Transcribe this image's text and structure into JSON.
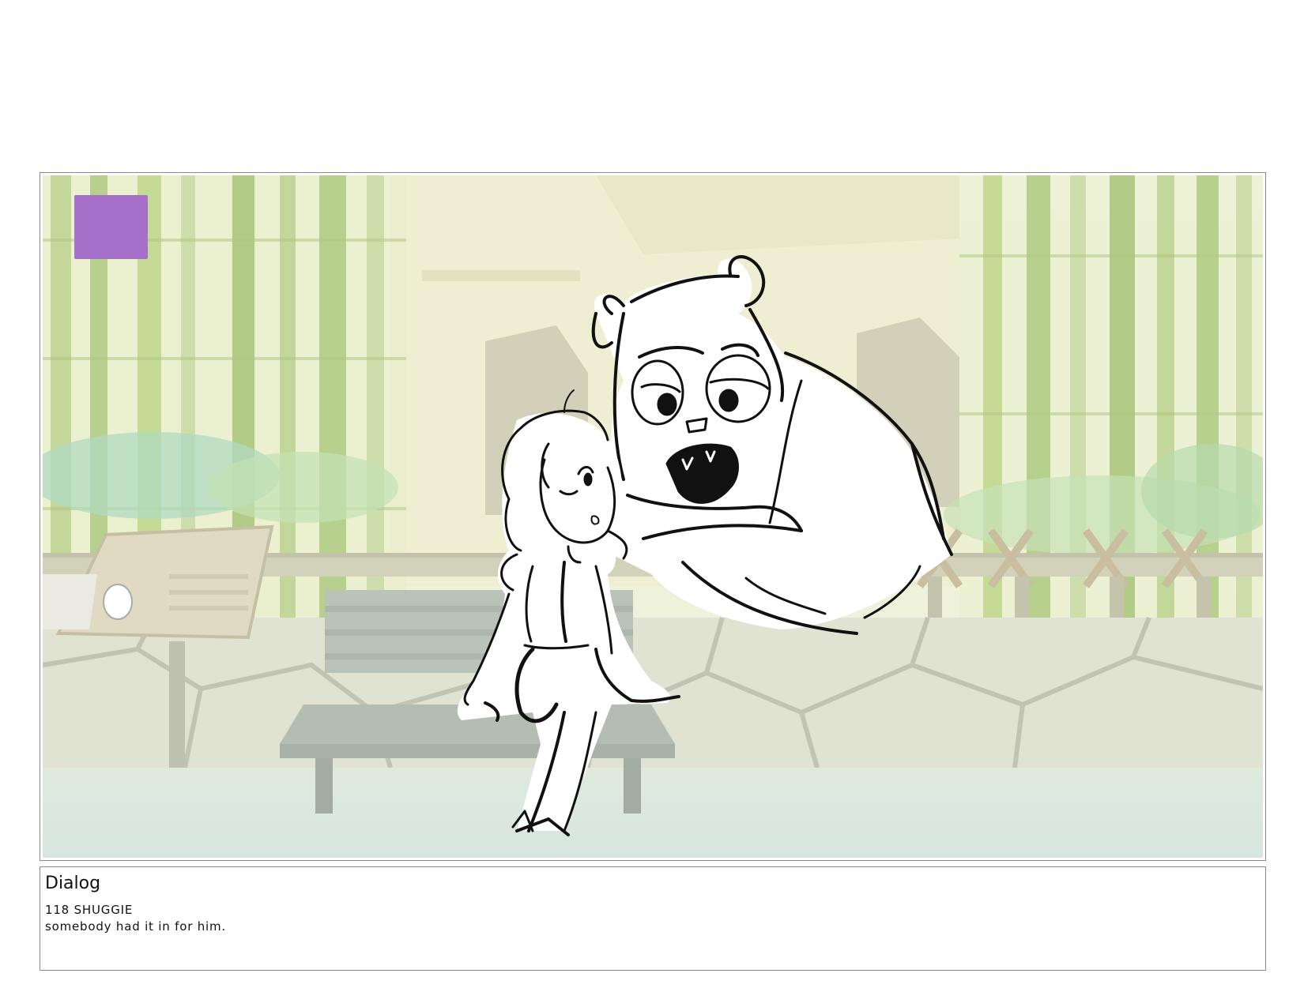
{
  "panel": {
    "marker_color": "#a66fc9"
  },
  "dialog": {
    "heading": "Dialog",
    "lines": [
      "118 SHUGGIE",
      "somebody had it in for him."
    ]
  }
}
